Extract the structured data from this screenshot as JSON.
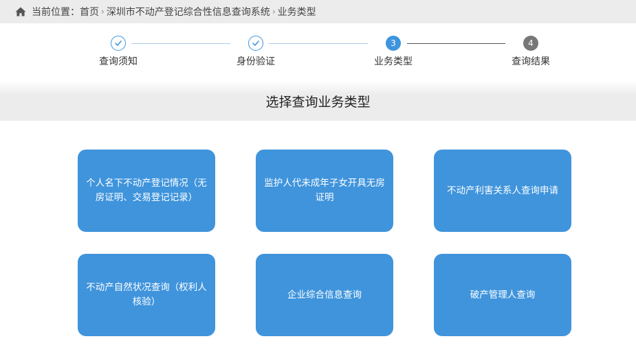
{
  "breadcrumb": {
    "prefix": "当前位置：",
    "items": [
      "首页",
      "深圳市不动产登记综合性信息查询系统",
      "业务类型"
    ],
    "separator": "›"
  },
  "steps": [
    {
      "number": "1",
      "label": "查询须知",
      "state": "done"
    },
    {
      "number": "2",
      "label": "身份验证",
      "state": "done"
    },
    {
      "number": "3",
      "label": "业务类型",
      "state": "current"
    },
    {
      "number": "4",
      "label": "查询结果",
      "state": "todo"
    }
  ],
  "section_title": "选择查询业务类型",
  "tiles": [
    {
      "label": "个人名下不动产登记情况（无房证明、交易登记记录）"
    },
    {
      "label": "监护人代未成年子女开具无房证明"
    },
    {
      "label": "不动产利害关系人查询申请"
    },
    {
      "label": "不动产自然状况查询（权利人核验）"
    },
    {
      "label": "企业综合信息查询"
    },
    {
      "label": "破产管理人查询"
    }
  ],
  "colors": {
    "accent": "#3e95dd",
    "tile": "#3f94dc",
    "step_todo": "#777777",
    "header_bg": "#ececec"
  },
  "icons": {
    "home": "home-icon",
    "check": "check-icon"
  }
}
